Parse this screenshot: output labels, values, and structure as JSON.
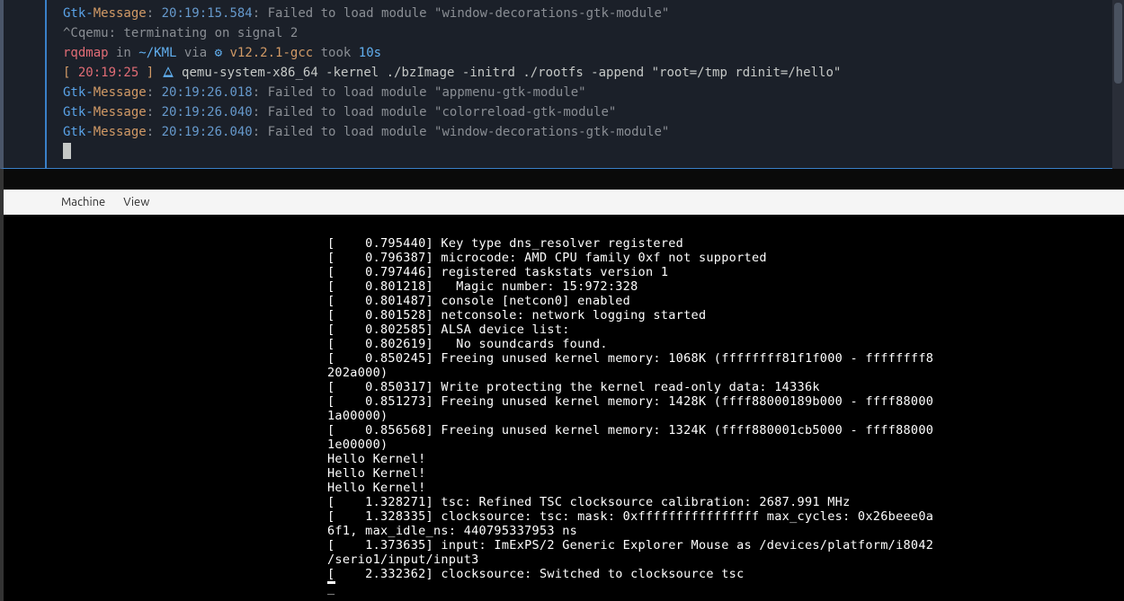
{
  "terminal": {
    "lines": [
      {
        "type": "gtk",
        "timestamp": "20:19:15.584",
        "message": ": Failed to load module \"window-decorations-gtk-module\""
      },
      {
        "type": "signal",
        "text": "^Cqemu: terminating on signal 2"
      },
      {
        "type": "prompt1",
        "user": "rqdmap",
        "in": " in ",
        "path": "~/KML",
        "via": " via ",
        "gear": "⚙ ",
        "version": "v12.2.1-gcc",
        "took": " took ",
        "duration": "10s"
      },
      {
        "type": "prompt2",
        "bracket_open": "[ ",
        "time": "20:19:25",
        "bracket_close": " ] ",
        "arch": "⮫ ",
        "cmd": "qemu-system-x86_64 -kernel ./bzImage -initrd ./rootfs -append \"root=/tmp rdinit=/hello\""
      },
      {
        "type": "gtk",
        "timestamp": "20:19:26.018",
        "message": ": Failed to load module \"appmenu-gtk-module\""
      },
      {
        "type": "gtk",
        "timestamp": "20:19:26.040",
        "message": ": Failed to load module \"colorreload-gtk-module\""
      },
      {
        "type": "gtk",
        "timestamp": "20:19:26.040",
        "message": ": Failed to load module \"window-decorations-gtk-module\""
      }
    ],
    "gtk_prefix": "Gtk-",
    "gtk_label": "Message"
  },
  "menubar": {
    "items": [
      "Machine",
      "View"
    ]
  },
  "qemu": {
    "lines": [
      "[    0.795440] Key type dns_resolver registered",
      "[    0.796387] microcode: AMD CPU family 0xf not supported",
      "[    0.797446] registered taskstats version 1",
      "[    0.801218]   Magic number: 15:972:328",
      "[    0.801487] console [netcon0] enabled",
      "[    0.801528] netconsole: network logging started",
      "[    0.802585] ALSA device list:",
      "[    0.802619]   No soundcards found.",
      "[    0.850245] Freeing unused kernel memory: 1068K (ffffffff81f1f000 - ffffffff8",
      "202a000)",
      "[    0.850317] Write protecting the kernel read-only data: 14336k",
      "[    0.851273] Freeing unused kernel memory: 1428K (ffff88000189b000 - ffff88000",
      "1a00000)",
      "[    0.856568] Freeing unused kernel memory: 1324K (ffff880001cb5000 - ffff88000",
      "1e00000)",
      "Hello Kernel!",
      "Hello Kernel!",
      "Hello Kernel!",
      "[    1.328271] tsc: Refined TSC clocksource calibration: 2687.991 MHz",
      "[    1.328335] clocksource: tsc: mask: 0xffffffffffffffff max_cycles: 0x26beee0a",
      "6f1, max_idle_ns: 440795337953 ns",
      "[    1.373635] input: ImExPS/2 Generic Explorer Mouse as /devices/platform/i8042",
      "/serio1/input/input3",
      "[    2.332362] clocksource: Switched to clocksource tsc"
    ]
  }
}
